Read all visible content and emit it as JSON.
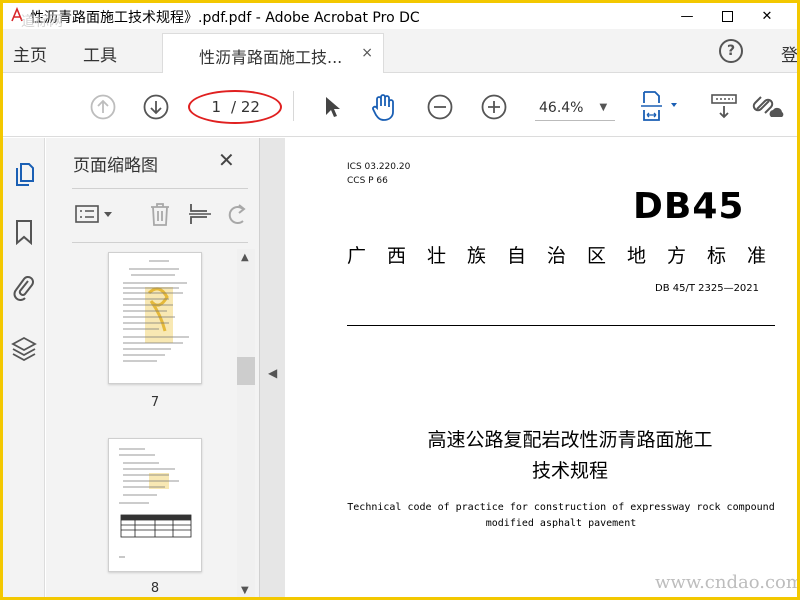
{
  "window": {
    "title": "性沥青路面施工技术规程》.pdf.pdf - Adobe Acrobat Pro DC",
    "watermark_top": "道标网",
    "minimize": "—",
    "close": "✕"
  },
  "menubar": {
    "home": "主页",
    "tools": "工具",
    "doc_tab": "性沥青路面施工技...",
    "doc_tab_close": "×",
    "help": "?",
    "login": "登"
  },
  "toolbar": {
    "page_current": "1",
    "page_total": "/ 22",
    "zoom": "46.4%",
    "zoom_arrow": "▼"
  },
  "panel": {
    "title": "页面缩略图",
    "close": "✕",
    "thumbnails": [
      {
        "page": "7"
      },
      {
        "page": "8"
      }
    ]
  },
  "document": {
    "ics": "ICS  03.220.20",
    "ccs": "CCS  P 66",
    "logo": "DB45",
    "authority": "广西壮族自治区地方标准",
    "code": "DB 45/T  2325—2021",
    "title_cn_line1": "高速公路复配岩改性沥青路面施工",
    "title_cn_line2": "技术规程",
    "title_en_line1": "Technical code of practice for construction of expressway rock compound",
    "title_en_line2": "modified asphalt pavement",
    "watermark_bottom": "www.cndao.com"
  },
  "colors": {
    "frame": "#f3c800",
    "annotation_ellipse": "#e02020",
    "accent_blue": "#1a5fb4"
  }
}
